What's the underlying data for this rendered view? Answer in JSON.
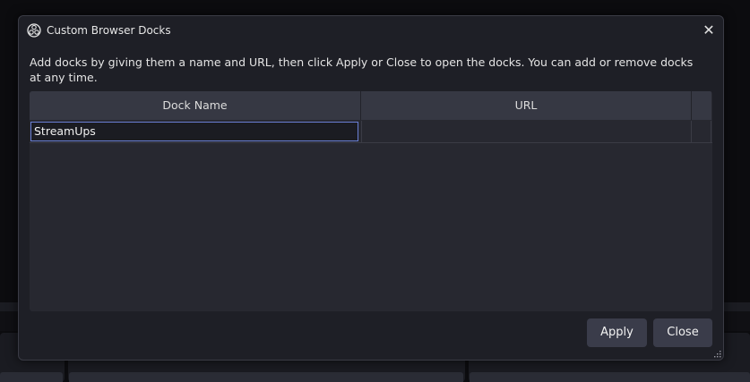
{
  "dialog": {
    "title": "Custom Browser Docks",
    "description": "Add docks by giving them a name and URL, then click Apply or Close to open the docks. You can add or remove docks at any time.",
    "close_symbol": "✕"
  },
  "table": {
    "columns": [
      "Dock Name",
      "URL"
    ],
    "rows": [
      {
        "name": "StreamUps",
        "url": ""
      }
    ]
  },
  "buttons": {
    "apply": "Apply",
    "close": "Close"
  },
  "icons": {
    "title": "obs-logo-icon",
    "close": "close-icon",
    "resize": "resize-grip-icon"
  },
  "colors": {
    "dialog_bg": "#1e1f26",
    "header_bg": "#363843",
    "button_bg": "#3a3c4a",
    "focus_border": "#6a7fd4"
  }
}
